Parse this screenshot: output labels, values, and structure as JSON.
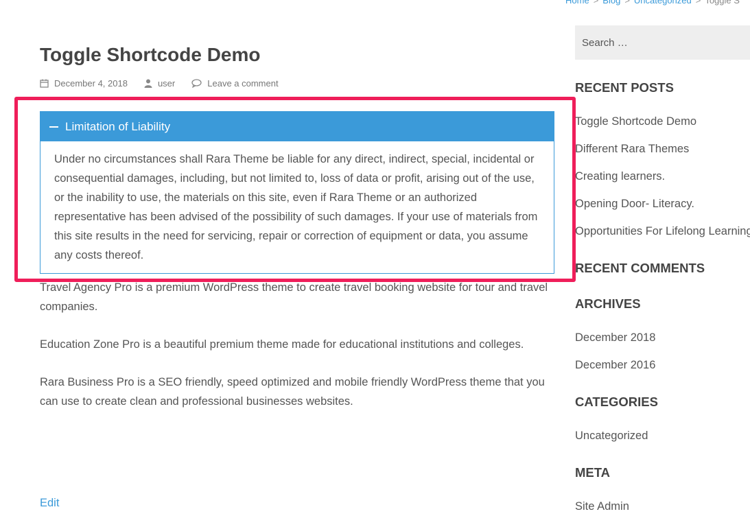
{
  "breadcrumb": {
    "items": [
      "Home",
      "Blog",
      "Uncategorized"
    ],
    "current": "Toggle S"
  },
  "post": {
    "title": "Toggle Shortcode Demo",
    "date": "December 4, 2018",
    "author": "user",
    "comment_link": "Leave a comment",
    "toggle": {
      "title": "Limitation of Liability",
      "body": "Under no circumstances shall Rara Theme be liable for any direct, indirect, special, incidental or consequential damages, including, but not limited to, loss of data or profit, arising out of the use, or the inability to use, the materials on this site, even if Rara Theme or an authorized representative has been advised of the possibility of such damages. If your use of materials from this site results in the need for servicing, repair or correction of equipment or data, you assume any costs thereof."
    },
    "paragraphs": [
      "Travel Agency Pro is a premium WordPress theme to create travel booking website for tour and travel companies.",
      "Education Zone Pro is a beautiful premium theme made for educational institutions and colleges.",
      "Rara Business Pro is a SEO friendly, speed optimized and mobile friendly WordPress theme that you can use to create clean and professional businesses websites."
    ],
    "edit_label": "Edit"
  },
  "sidebar": {
    "search_placeholder": "Search …",
    "recent_posts": {
      "heading": "RECENT POSTS",
      "items": [
        "Toggle Shortcode Demo",
        "Different Rara Themes",
        "Creating learners.",
        "Opening Door- Literacy.",
        "Opportunities For Lifelong Learning"
      ]
    },
    "recent_comments": {
      "heading": "RECENT COMMENTS"
    },
    "archives": {
      "heading": "ARCHIVES",
      "items": [
        "December 2018",
        "December 2016"
      ]
    },
    "categories": {
      "heading": "CATEGORIES",
      "items": [
        "Uncategorized"
      ]
    },
    "meta": {
      "heading": "META",
      "items": [
        "Site Admin"
      ]
    }
  },
  "colors": {
    "accent": "#3b9ad9",
    "highlight": "#ef1e5a"
  }
}
